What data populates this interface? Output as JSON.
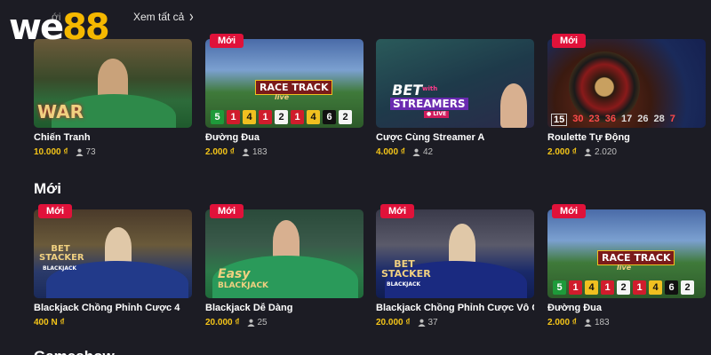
{
  "brand": {
    "part1": "we",
    "part2": "88"
  },
  "header": {
    "partial_title": "ới",
    "see_all": "Xem tất cả",
    "chevron_icon": "chevron-right-icon"
  },
  "sections": [
    {
      "title": ""
    },
    {
      "title": "Mới"
    },
    {
      "title": "Gameshow"
    }
  ],
  "badge_label": "Mới",
  "row1": [
    {
      "name": "Chiến Tranh",
      "price": "10.000 ₫",
      "players": "73",
      "badge": false,
      "art_text": "WAR"
    },
    {
      "name": "Đường Đua",
      "price": "2.000 ₫",
      "players": "183",
      "badge": true,
      "art_text": "RACE TRACK",
      "art_sub": "live",
      "results": [
        [
          "5",
          "green"
        ],
        [
          "1",
          "red"
        ],
        [
          "4",
          "yellow"
        ],
        [
          "1",
          "red"
        ],
        [
          "2",
          "white"
        ],
        [
          "1",
          "red"
        ],
        [
          "4",
          "yellow"
        ],
        [
          "6",
          "black"
        ],
        [
          "2",
          "white"
        ]
      ]
    },
    {
      "name": "Cược Cùng Streamer A",
      "price": "4.000 ₫",
      "players": "42",
      "badge": false,
      "art_text": "BET",
      "art_sub": "STREAMERS",
      "art_small": "with",
      "art_live": "● LIVE"
    },
    {
      "name": "Roulette Tự Động",
      "price": "2.000 ₫",
      "players": "2.020",
      "badge": true,
      "roulette_results": [
        "15",
        "30",
        "23",
        "36",
        "17",
        "26",
        "28",
        "7"
      ]
    }
  ],
  "row2": [
    {
      "name": "Blackjack Chồng Phỉnh Cược 4",
      "price": "400 N ₫",
      "players": "",
      "badge": true,
      "art_text": "BET STACKER",
      "art_sub": "BLACKJACK"
    },
    {
      "name": "Blackjack Dễ Dàng",
      "price": "20.000 ₫",
      "players": "25",
      "badge": true,
      "art_text": "Easy",
      "art_sub": "BLACKJACK"
    },
    {
      "name": "Blackjack Chồng Phỉnh Cược Vô C...",
      "price": "20.000 ₫",
      "players": "37",
      "badge": true,
      "art_text": "BET STACKER",
      "art_sub": "BLACKJACK"
    },
    {
      "name": "Đường Đua",
      "price": "2.000 ₫",
      "players": "183",
      "badge": true,
      "art_text": "RACE TRACK",
      "art_sub": "live",
      "results": [
        [
          "5",
          "green"
        ],
        [
          "1",
          "red"
        ],
        [
          "4",
          "yellow"
        ],
        [
          "1",
          "red"
        ],
        [
          "2",
          "white"
        ],
        [
          "1",
          "red"
        ],
        [
          "4",
          "yellow"
        ],
        [
          "6",
          "black"
        ],
        [
          "2",
          "white"
        ]
      ]
    }
  ],
  "colors": {
    "background": "#1c1c24",
    "accent_yellow": "#f5c518",
    "badge_red": "#e0123a"
  }
}
